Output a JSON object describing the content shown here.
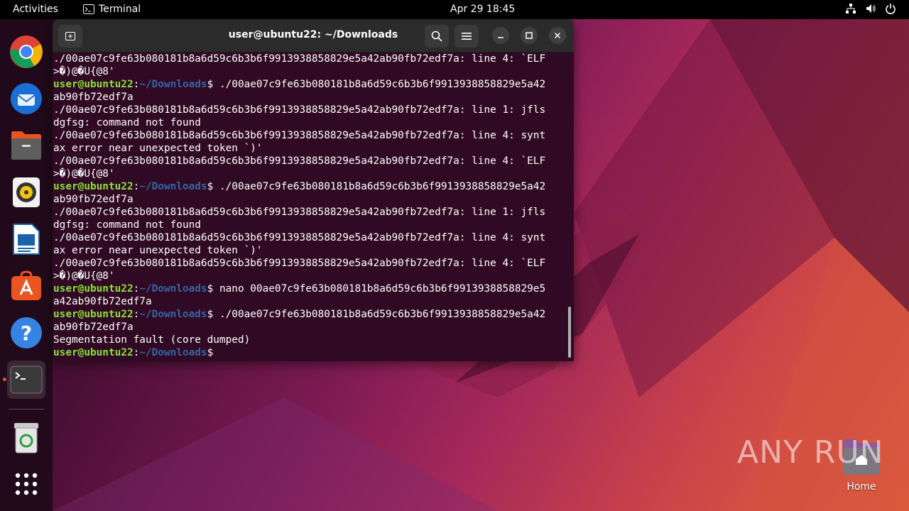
{
  "topbar": {
    "activities": "Activities",
    "app_name": "Terminal",
    "clock": "Apr 29  18:45"
  },
  "dock": {
    "items": [
      {
        "name": "Google Chrome",
        "icon": "chrome-icon"
      },
      {
        "name": "Thunderbird Mail",
        "icon": "thunderbird-icon"
      },
      {
        "name": "Files",
        "icon": "files-icon"
      },
      {
        "name": "Rhythmbox",
        "icon": "rhythmbox-icon"
      },
      {
        "name": "LibreOffice Writer",
        "icon": "writer-icon"
      },
      {
        "name": "Ubuntu Software",
        "icon": "software-icon"
      },
      {
        "name": "Help",
        "icon": "help-icon"
      },
      {
        "name": "Terminal",
        "icon": "terminal-icon"
      },
      {
        "name": "Trash",
        "icon": "trash-icon"
      },
      {
        "name": "Show Applications",
        "icon": "app-grid-icon"
      }
    ]
  },
  "terminal": {
    "title": "user@ubuntu22: ~/Downloads",
    "prompt_user": "user@ubuntu22",
    "prompt_path": "~/Downloads",
    "lines": [
      {
        "type": "out",
        "text": "./00ae07c9fe63b080181b8a6d59c6b3b6f9913938858829e5a42ab90fb72edf7a: line 4: `ELF"
      },
      {
        "type": "out",
        "text": ">�)@�U{@8'"
      },
      {
        "type": "cmd",
        "text": "./00ae07c9fe63b080181b8a6d59c6b3b6f9913938858829e5a42"
      },
      {
        "type": "out",
        "text": "ab90fb72edf7a"
      },
      {
        "type": "out",
        "text": "./00ae07c9fe63b080181b8a6d59c6b3b6f9913938858829e5a42ab90fb72edf7a: line 1: jfls"
      },
      {
        "type": "out",
        "text": "dgfsg: command not found"
      },
      {
        "type": "out",
        "text": "./00ae07c9fe63b080181b8a6d59c6b3b6f9913938858829e5a42ab90fb72edf7a: line 4: synt"
      },
      {
        "type": "out",
        "text": "ax error near unexpected token `)'"
      },
      {
        "type": "out",
        "text": "./00ae07c9fe63b080181b8a6d59c6b3b6f9913938858829e5a42ab90fb72edf7a: line 4: `ELF"
      },
      {
        "type": "out",
        "text": ">�)@�U{@8'"
      },
      {
        "type": "cmd",
        "text": "./00ae07c9fe63b080181b8a6d59c6b3b6f9913938858829e5a42"
      },
      {
        "type": "out",
        "text": "ab90fb72edf7a"
      },
      {
        "type": "out",
        "text": "./00ae07c9fe63b080181b8a6d59c6b3b6f9913938858829e5a42ab90fb72edf7a: line 1: jfls"
      },
      {
        "type": "out",
        "text": "dgfsg: command not found"
      },
      {
        "type": "out",
        "text": "./00ae07c9fe63b080181b8a6d59c6b3b6f9913938858829e5a42ab90fb72edf7a: line 4: synt"
      },
      {
        "type": "out",
        "text": "ax error near unexpected token `)'"
      },
      {
        "type": "out",
        "text": "./00ae07c9fe63b080181b8a6d59c6b3b6f9913938858829e5a42ab90fb72edf7a: line 4: `ELF"
      },
      {
        "type": "out",
        "text": ">�)@�U{@8'"
      },
      {
        "type": "cmd",
        "text": "nano 00ae07c9fe63b080181b8a6d59c6b3b6f9913938858829e5"
      },
      {
        "type": "out",
        "text": "a42ab90fb72edf7a"
      },
      {
        "type": "cmd",
        "text": "./00ae07c9fe63b080181b8a6d59c6b3b6f9913938858829e5a42"
      },
      {
        "type": "out",
        "text": "ab90fb72edf7a"
      },
      {
        "type": "out",
        "text": "Segmentation fault (core dumped)"
      },
      {
        "type": "cmd",
        "text": ""
      }
    ]
  },
  "desktop": {
    "home_label": "Home",
    "watermark": "ANY RUN"
  },
  "colors": {
    "terminal_bg": "#300a24",
    "prompt_user": "#8ae234",
    "prompt_path": "#3465a4",
    "accent": "#e95420"
  }
}
